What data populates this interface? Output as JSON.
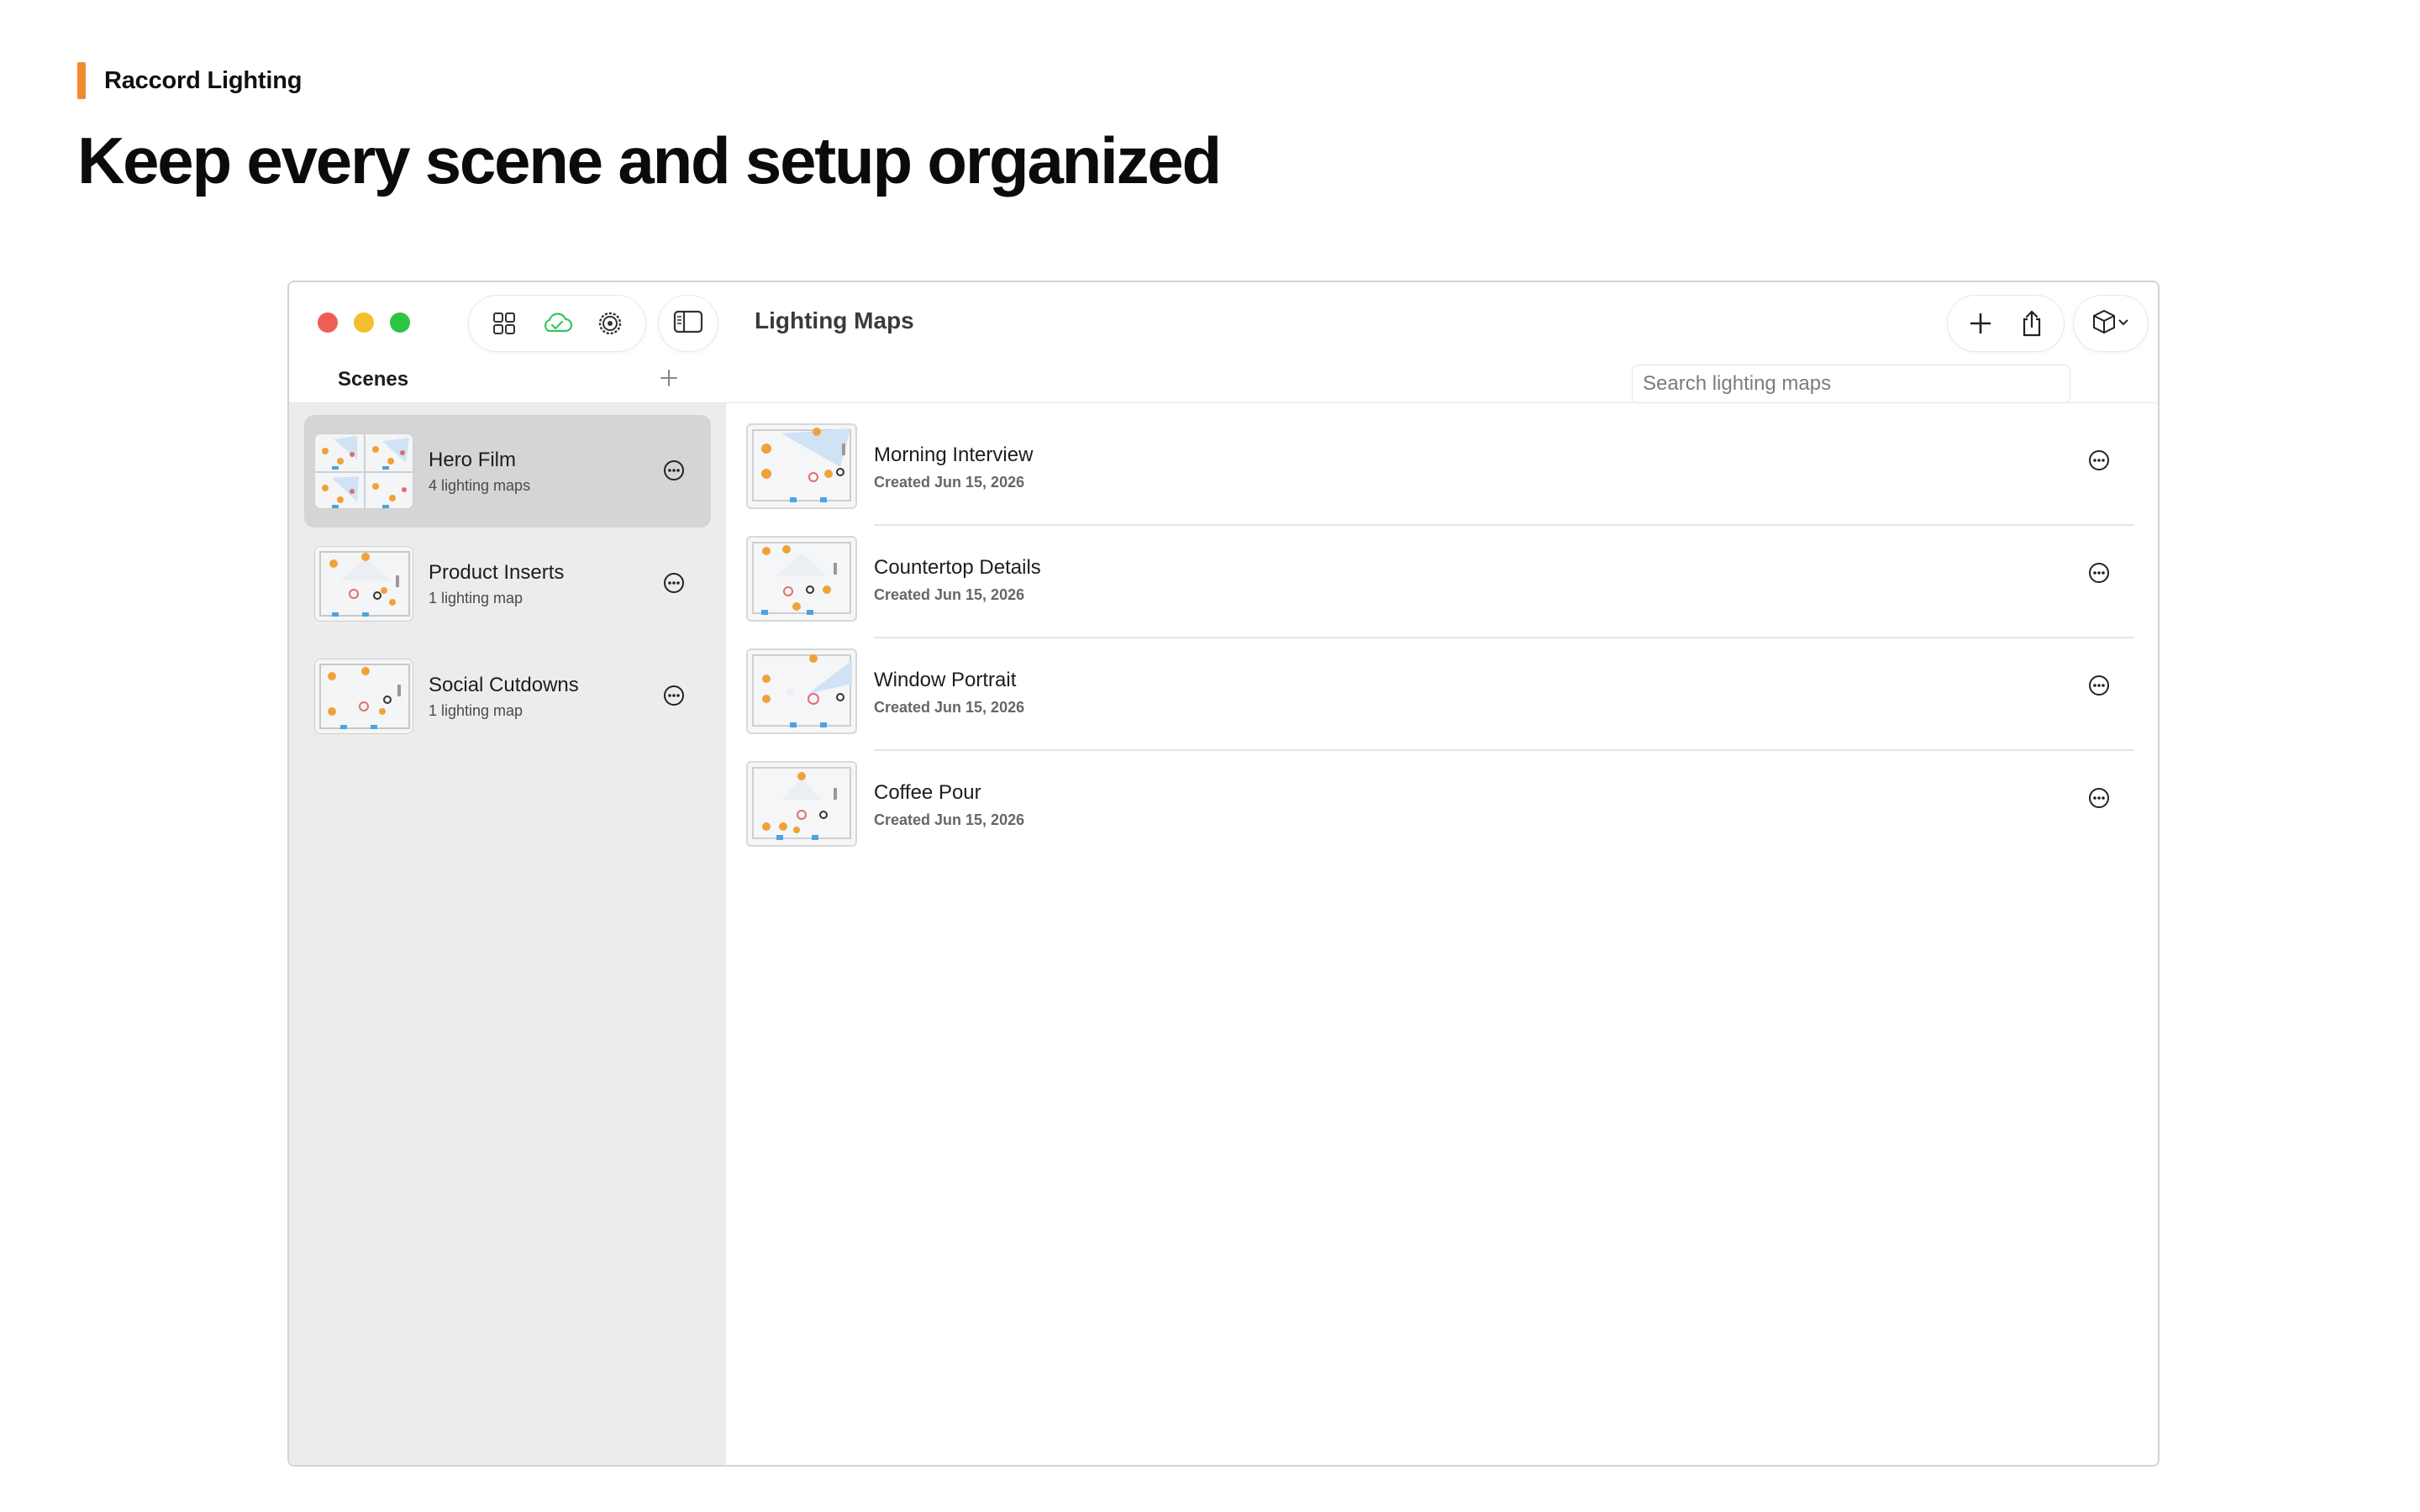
{
  "brand": {
    "name": "Raccord Lighting",
    "accent": "#f28b2e"
  },
  "headline": "Keep every scene and setup organized",
  "window": {
    "title": "Lighting Maps",
    "toolbar": {
      "left_icons": [
        "grid-icon",
        "cloud-check-icon",
        "gear-icon"
      ],
      "sidebar_toggle_icon": "sidebar-icon",
      "right_icons": [
        "plus-icon",
        "share-icon",
        "cube-icon",
        "chevron-down-icon"
      ]
    }
  },
  "sidebar": {
    "title": "Scenes",
    "add_icon": "plus-icon",
    "scenes": [
      {
        "name": "Hero Film",
        "count": "4 lighting maps",
        "selected": true
      },
      {
        "name": "Product Inserts",
        "count": "1 lighting map",
        "selected": false
      },
      {
        "name": "Social Cutdowns",
        "count": "1 lighting map",
        "selected": false
      }
    ]
  },
  "search": {
    "placeholder": "Search lighting maps",
    "value": ""
  },
  "maps": [
    {
      "name": "Morning Interview",
      "date": "Created Jun 15, 2026"
    },
    {
      "name": "Countertop Details",
      "date": "Created Jun 15, 2026"
    },
    {
      "name": "Window Portrait",
      "date": "Created Jun 15, 2026"
    },
    {
      "name": "Coffee Pour",
      "date": "Created Jun 15, 2026"
    }
  ],
  "colors": {
    "light_orange": "#f0a23a",
    "light_pink": "#e26d6d",
    "light_blue": "#4ea3e0",
    "selected_bg": "#d5d5d5",
    "green_cloud": "#34c759"
  }
}
